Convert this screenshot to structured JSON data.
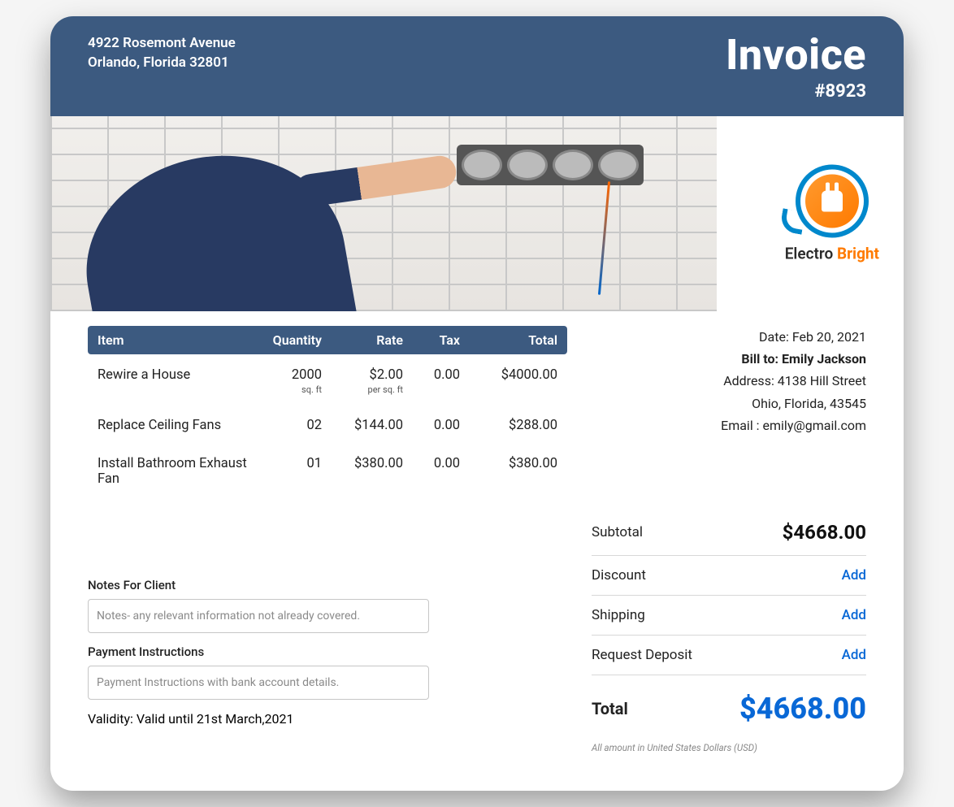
{
  "company": {
    "address_line1": "4922 Rosemont Avenue",
    "address_line2": "Orlando, Florida 32801"
  },
  "invoice": {
    "title": "Invoice",
    "number": "#8923"
  },
  "logo": {
    "text_part1": "Electro",
    "text_part2": "Bright"
  },
  "meta": {
    "date_label": "Date: ",
    "date_value": "Feb 20, 2021",
    "bill_to_label": "Bill to: ",
    "bill_to_name": "Emily Jackson",
    "address_label": "Address: ",
    "address_line1": "4138 Hill Street",
    "address_line2": "Ohio, Florida, 43545",
    "email_label": "Email : ",
    "email_value": "emily@gmail.com"
  },
  "table": {
    "headers": {
      "item": "Item",
      "quantity": "Quantity",
      "rate": "Rate",
      "tax": "Tax",
      "total": "Total"
    },
    "rows": [
      {
        "item": "Rewire a House",
        "qty": "2000",
        "qty_unit": "sq. ft",
        "rate": "$2.00",
        "rate_unit": "per sq. ft",
        "tax": "0.00",
        "total": "$4000.00"
      },
      {
        "item": "Replace Ceiling Fans",
        "qty": "02",
        "qty_unit": "",
        "rate": "$144.00",
        "rate_unit": "",
        "tax": "0.00",
        "total": "$288.00"
      },
      {
        "item": "Install Bathroom Exhaust Fan",
        "qty": "01",
        "qty_unit": "",
        "rate": "$380.00",
        "rate_unit": "",
        "tax": "0.00",
        "total": "$380.00"
      }
    ]
  },
  "notes": {
    "label": "Notes For Client",
    "placeholder": "Notes- any relevant information not already covered."
  },
  "payment": {
    "label": "Payment Instructions",
    "placeholder": "Payment Instructions with bank account details."
  },
  "validity": {
    "label": "Validity: ",
    "value": "Valid until 21st March,2021"
  },
  "summary": {
    "subtotal_label": "Subtotal",
    "subtotal_value": "$4668.00",
    "discount_label": "Discount",
    "shipping_label": "Shipping",
    "deposit_label": "Request Deposit",
    "add_label": "Add",
    "total_label": "Total",
    "total_value": "$4668.00",
    "currency_note": "All amount in United States Dollars (USD)"
  }
}
